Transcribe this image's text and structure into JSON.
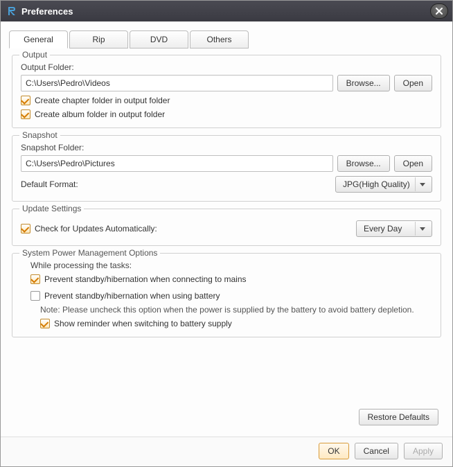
{
  "window": {
    "title": "Preferences"
  },
  "tabs": {
    "general": "General",
    "rip": "Rip",
    "dvd": "DVD",
    "others": "Others"
  },
  "output": {
    "group_title": "Output",
    "folder_label": "Output Folder:",
    "folder_value": "C:\\Users\\Pedro\\Videos",
    "browse": "Browse...",
    "open": "Open",
    "chapter_folder": "Create chapter folder in output folder",
    "album_folder": "Create album folder in output folder"
  },
  "snapshot": {
    "group_title": "Snapshot",
    "folder_label": "Snapshot Folder:",
    "folder_value": "C:\\Users\\Pedro\\Pictures",
    "browse": "Browse...",
    "open": "Open",
    "default_format_label": "Default Format:",
    "default_format_value": "JPG(High Quality)"
  },
  "update": {
    "group_title": "Update Settings",
    "check_label": "Check for Updates Automatically:",
    "interval": "Every Day"
  },
  "power": {
    "group_title": "System Power Management Options",
    "while_label": "While processing the tasks:",
    "prevent_mains": "Prevent standby/hibernation when connecting to mains",
    "prevent_battery": "Prevent standby/hibernation when using battery",
    "note": "Note: Please uncheck this option when the power is supplied by the battery to avoid battery depletion.",
    "show_reminder": "Show reminder when switching to battery supply"
  },
  "buttons": {
    "restore": "Restore Defaults",
    "ok": "OK",
    "cancel": "Cancel",
    "apply": "Apply"
  }
}
